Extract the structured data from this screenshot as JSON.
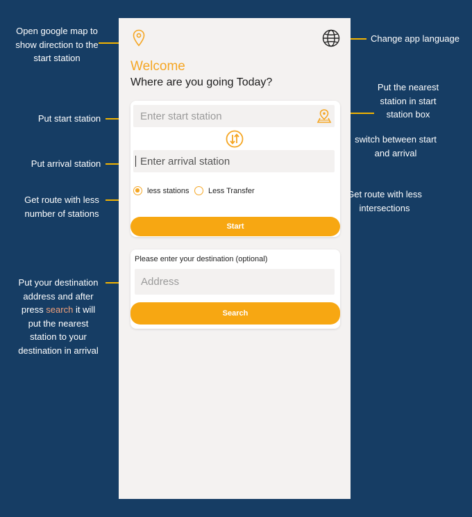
{
  "annotations": {
    "map": [
      "Open google map to",
      "show direction to the",
      "start station"
    ],
    "language": "Change app language",
    "nearest": [
      "Put the nearest",
      "station in start",
      "station box"
    ],
    "start": "Put start station",
    "switch": [
      "switch between start",
      "and arrival"
    ],
    "arrival": "Put arrival station",
    "less_stations": [
      "Get route with less",
      "number of stations"
    ],
    "less_transfer": [
      "Get route with less",
      "intersections"
    ],
    "destination_lines": [
      "Put your destination",
      "address and after"
    ],
    "destination_press": "press",
    "destination_search": "search",
    "destination_it_will": "it will",
    "destination_tail": [
      "put the nearest",
      "station to your",
      "destination in arrival"
    ]
  },
  "app": {
    "welcome": "Welcome",
    "subtitle": "Where are you going Today?",
    "start_placeholder": "Enter start station",
    "arrival_placeholder": "Enter arrival station",
    "option_less_stations": "less stations",
    "option_less_transfer": "Less Transfer",
    "selected_option": "less stations",
    "start_button": "Start",
    "destination_label": "Please enter your destination (optional)",
    "address_placeholder": "Address",
    "search_button": "Search"
  },
  "icons": {
    "map_pin": "map-pin-icon",
    "globe": "globe-icon",
    "nearest_station": "location-map-icon",
    "swap": "swap-arrows-icon"
  },
  "colors": {
    "background": "#163d64",
    "accent": "#f5a623",
    "button": "#f7a712",
    "annotation_line": "#f4b400",
    "highlight_text": "#f0a07a"
  }
}
